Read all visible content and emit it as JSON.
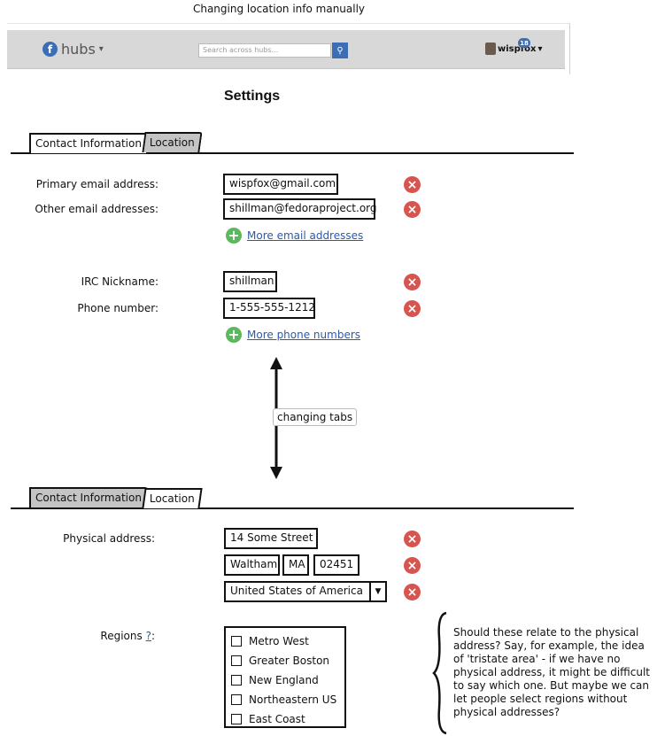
{
  "caption": "Changing location info manually",
  "header": {
    "brand": "hubs",
    "brand_caret": "⌄",
    "search_placeholder": "Search across hubs...",
    "search_icon": "search-icon",
    "username": "wispfox",
    "notification_count": "18"
  },
  "page_title": "Settings",
  "tabs_top": {
    "contact": "Contact Information",
    "location": "Location",
    "active": "contact"
  },
  "contact": {
    "primary_email_label": "Primary email address:",
    "primary_email": "wispfox@gmail.com",
    "other_email_label": "Other email addresses:",
    "other_email": "shillman@fedoraproject.org",
    "add_email": "More email addresses",
    "irc_label": "IRC Nickname:",
    "irc": "shillman",
    "phone_label": "Phone number:",
    "phone": "1-555-555-1212",
    "add_phone": "More phone numbers"
  },
  "transition_label": "changing tabs",
  "tabs_bottom": {
    "contact": "Contact Information",
    "location": "Location",
    "active": "location"
  },
  "location": {
    "address_label": "Physical address:",
    "street": "14 Some Street",
    "city": "Waltham",
    "state": "MA",
    "zip": "02451",
    "country": "United States of America",
    "regions_label": "Regions",
    "regions_help": "?",
    "regions_colon": ":",
    "regions": [
      "Metro West",
      "Greater Boston",
      "New England",
      "Northeastern US",
      "East Coast"
    ]
  },
  "note": "Should these relate to the physical address? Say, for example, the idea of 'tristate area' - if we have no physical address, it might be difficult to say which one. But maybe we can let people select regions without physical addresses?",
  "colors": {
    "remove": "#d9534f",
    "add": "#5cb85c",
    "link": "#2a5aa8",
    "brand": "#3c6eb4"
  }
}
